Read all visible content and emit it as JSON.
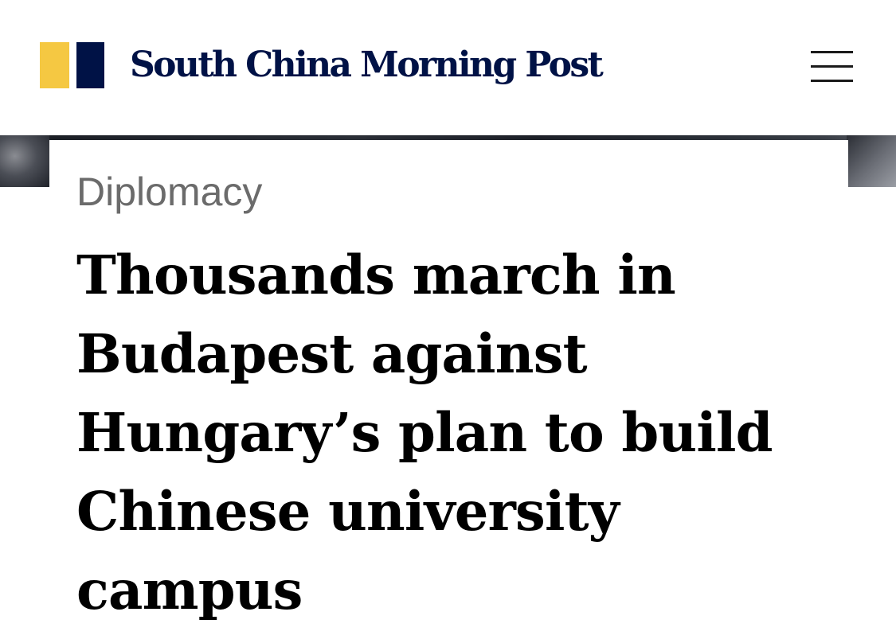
{
  "header": {
    "brand_name": "South China Morning Post",
    "logo_colors": {
      "yellow": "#f5c842",
      "navy": "#001246"
    },
    "menu_icon": "hamburger-menu-icon"
  },
  "article": {
    "section": "Diplomacy",
    "headline": "Thousands march in Budapest against Hungary’s plan to build Chinese university campus"
  }
}
